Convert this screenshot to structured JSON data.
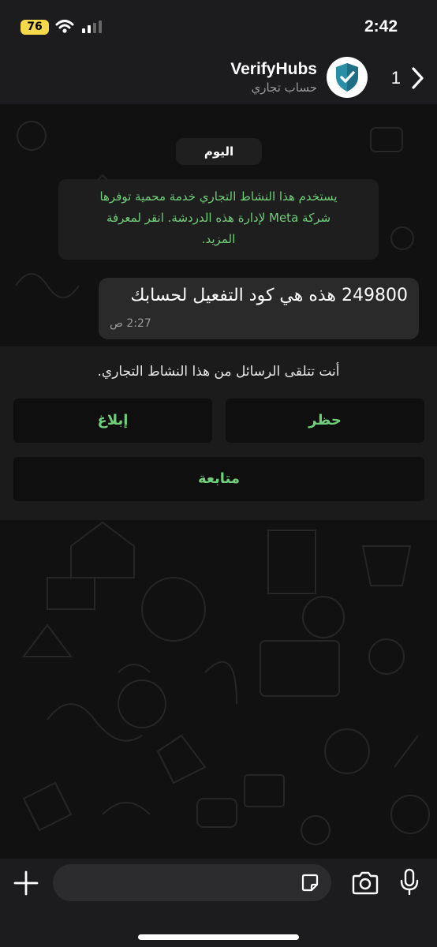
{
  "status_bar": {
    "battery": "76",
    "time": "2:42"
  },
  "header": {
    "unread_count": "1",
    "contact_name": "VerifyHubs",
    "contact_subtitle": "حساب تجاري"
  },
  "chat": {
    "date_label": "اليوم",
    "system_notice_line1": "يستخدم هذا النشاط التجاري خدمة محمية توفرها",
    "system_notice_line2": "شركة Meta لإدارة هذه الدردشة. انقر لمعرفة",
    "system_notice_line3": "المزيد.",
    "messages": [
      {
        "text": "249800 هذه هي كود التفعيل لحسابك",
        "time": "2:27 ص"
      }
    ]
  },
  "business_panel": {
    "text": "أنت تتلقى الرسائل من هذا النشاط التجاري.",
    "block_label": "حظر",
    "report_label": "إبلاغ",
    "continue_label": "متابعة"
  },
  "colors": {
    "accent_green": "#6fcf7a",
    "battery_yellow": "#f5d94a",
    "bubble": "#2a2a2a"
  },
  "icons": {
    "back": "chevron-right-icon",
    "avatar": "shield-check-icon",
    "plus": "plus-icon",
    "sticker": "sticker-icon",
    "camera": "camera-icon",
    "mic": "microphone-icon"
  }
}
